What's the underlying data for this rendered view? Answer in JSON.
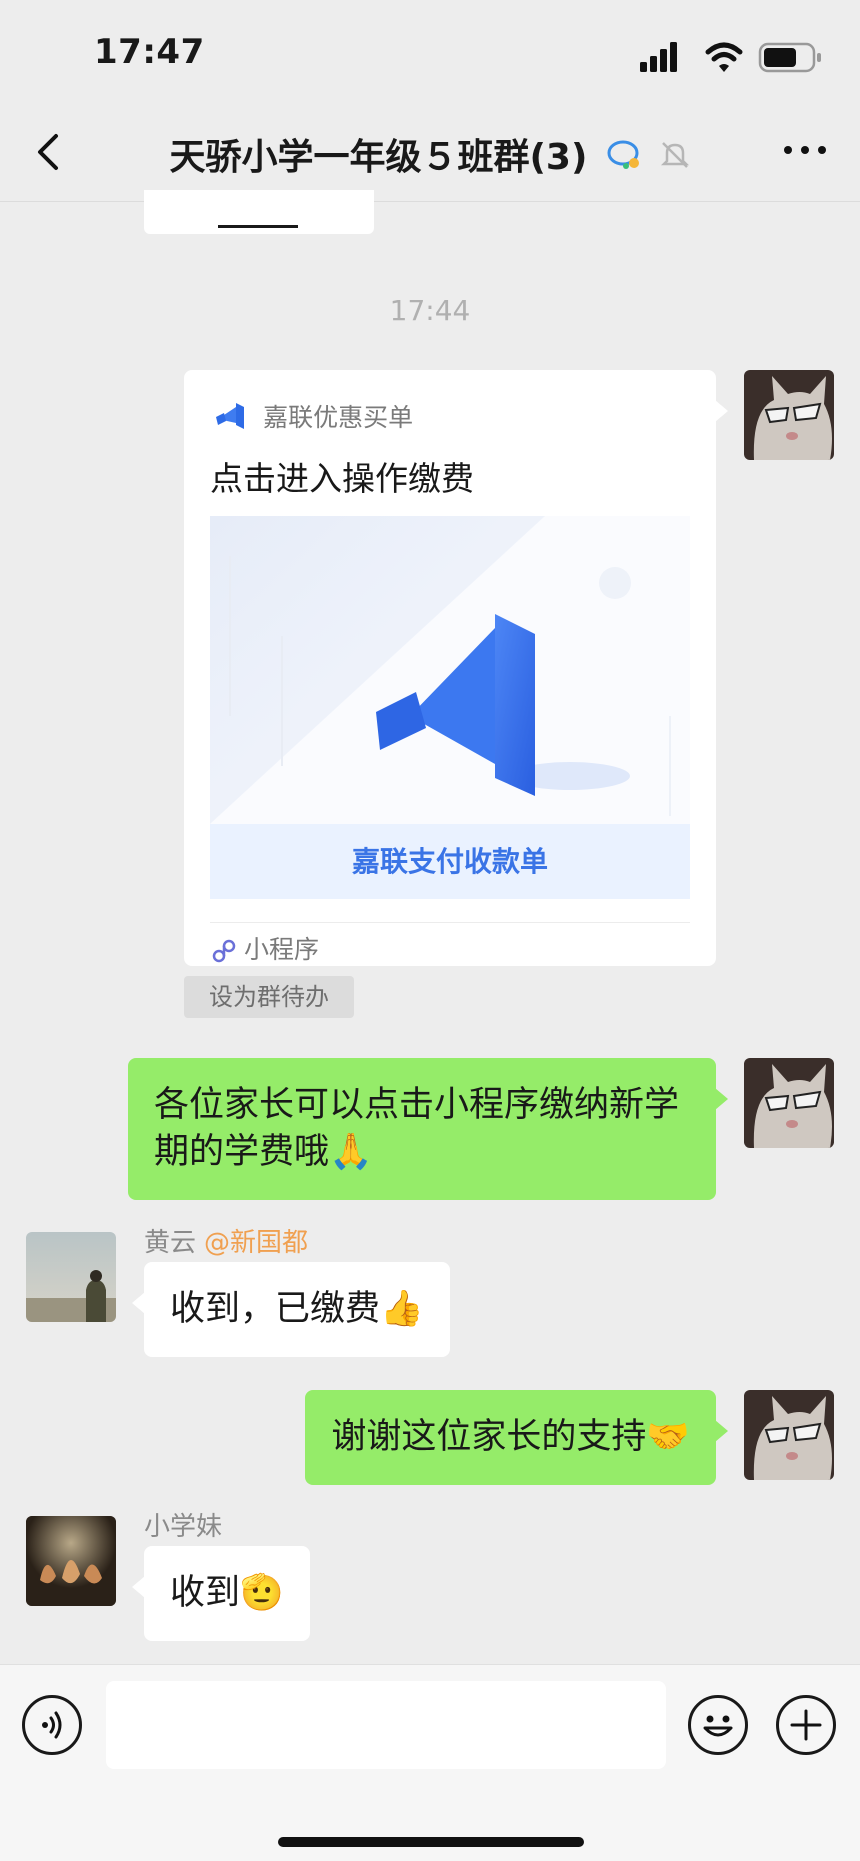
{
  "status": {
    "time": "17:47"
  },
  "nav": {
    "title": "天骄小学一年级５班群(3)"
  },
  "chat": {
    "timestamp": "17:44",
    "mini_program": {
      "source": "嘉联优惠买单",
      "title": "点击进入操作缴费",
      "banner": "嘉联支付收款单",
      "footer": "小程序",
      "todo_tag": "设为群待办",
      "brand_color": "#3a74e6"
    },
    "messages": [
      {
        "text": "各位家长可以点击小程序缴纳新学期的学费哦🙏"
      },
      {
        "sender": "黄云",
        "mention": "@新国都",
        "text": "收到，已缴费👍"
      },
      {
        "text": "谢谢这位家长的支持🤝"
      },
      {
        "sender": "小学妹",
        "text": "收到🫡"
      }
    ]
  },
  "colors": {
    "self_bubble": "#95ec69",
    "other_bubble": "#ffffff",
    "background": "#ededed"
  }
}
